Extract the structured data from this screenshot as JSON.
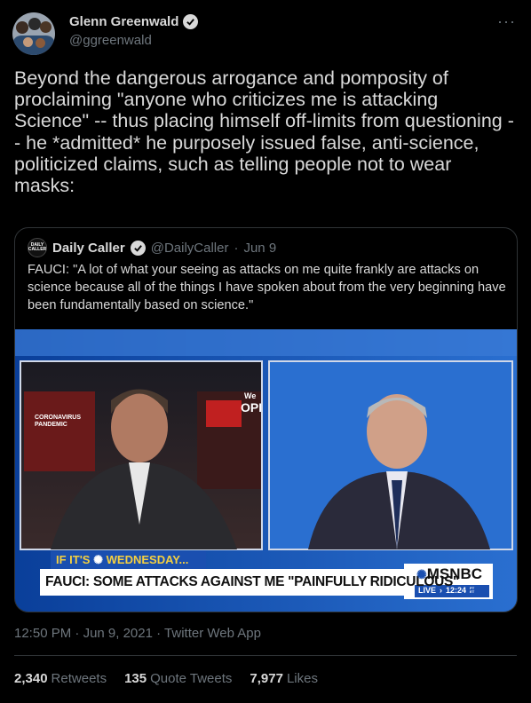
{
  "author": {
    "name": "Glenn Greenwald",
    "handle": "@ggreenwald",
    "verified_icon": "verified-badge-icon"
  },
  "more_icon": "···",
  "tweet_text": "Beyond the dangerous arrogance and pomposity of proclaiming \"anyone who criticizes me is attacking Science\" -- thus placing himself off-limits from questioning -- he *admitted* he purposely issued false, anti-science, politicized claims, such as telling people not to wear masks:",
  "quoted": {
    "logo_text": "DAILY CALLER",
    "name": "Daily Caller",
    "handle": "@DailyCaller",
    "separator": "·",
    "date": "Jun 9",
    "text": "FAUCI: \"A lot of what your seeing as attacks on me quite frankly are attacks on science because all of the things I have spoken about from the very beginning have been fundamentally based on science.\"",
    "media": {
      "left_graphic_text": "CORONAVIRUS PANDEMIC",
      "screen_text_1": "We",
      "screen_text_2": "OPI",
      "lower_third_tag": "IF IT'S",
      "lower_third_tag_day": "WEDNESDAY...",
      "headline": "FAUCI: SOME ATTACKS AGAINST ME \"PAINFULLY RIDICULOUS\"",
      "network": "MSNBC",
      "live_label": "LIVE",
      "live_time": "12:24",
      "time_zone_top": "PT",
      "time_zone_bottom": "ET"
    }
  },
  "meta": {
    "time": "12:50 PM",
    "date": "Jun 9, 2021",
    "source": "Twitter Web App",
    "separator": "·"
  },
  "stats": {
    "retweets_count": "2,340",
    "retweets_label": "Retweets",
    "quotes_count": "135",
    "quotes_label": "Quote Tweets",
    "likes_count": "7,977",
    "likes_label": "Likes"
  }
}
